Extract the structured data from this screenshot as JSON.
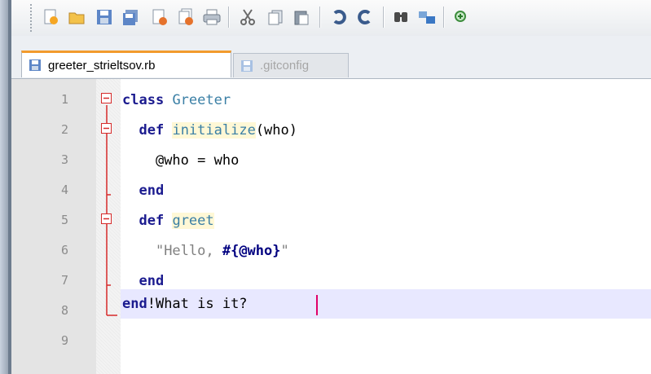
{
  "toolbar": {
    "buttons": [
      "new-file-icon",
      "open-folder-icon",
      "save-icon",
      "save-all-icon",
      "close-icon",
      "close-all-icon",
      "print-icon",
      "cut-icon",
      "copy-icon",
      "paste-icon",
      "undo-icon",
      "redo-icon",
      "find-icon",
      "replace-icon",
      "zoom-in-icon"
    ]
  },
  "tabs": [
    {
      "label": "greeter_strieltsov.rb",
      "active": true
    },
    {
      "label": ".gitconfig",
      "active": false
    }
  ],
  "editor": {
    "line_numbers": [
      "1",
      "2",
      "3",
      "4",
      "5",
      "6",
      "7",
      "8",
      "9"
    ],
    "lines": {
      "l1": {
        "kw": "class",
        "name": "Greeter"
      },
      "l2": {
        "kw": "def",
        "name": "initialize",
        "args": "(who)"
      },
      "l3": {
        "text": "@who = who"
      },
      "l4": {
        "kw": "end"
      },
      "l5": {
        "kw": "def",
        "name": "greet"
      },
      "l6": {
        "str_open": "\"Hello, ",
        "interp": "#{@who}",
        "str_close": "\""
      },
      "l7": {
        "kw": "end"
      },
      "l8": {
        "kw": "end",
        "rest": "!What is it?"
      }
    },
    "current_line": 8
  },
  "colors": {
    "keyword": "#1b1b8f",
    "class_name": "#3a7fa5",
    "string": "#808080",
    "fold_marker": "#d62a2a",
    "active_tab_accent": "#f29b2d",
    "current_line_bg": "#e8e8ff"
  }
}
